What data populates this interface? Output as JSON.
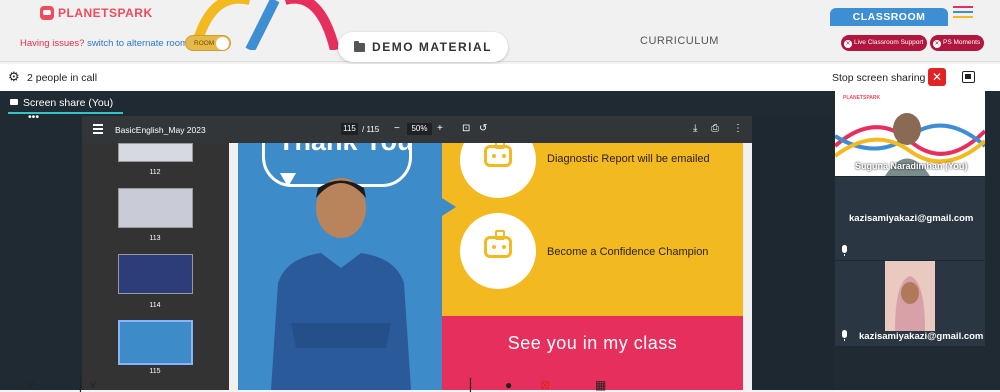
{
  "app": {
    "brand": "PLANETSPARK"
  },
  "header": {
    "issues_text": "Having issues?",
    "switch_text": "switch to alternate room",
    "toggle_label": "ROOM",
    "demo_button": "DEMO MATERIAL",
    "curriculum_label": "CURRICULUM",
    "classroom_tab": "CLASSROOM",
    "live_support": "Live Classroom Support",
    "ps_moments": "PS Moments"
  },
  "call": {
    "people_count": "2 people in call",
    "stop_share": "Stop screen sharing",
    "screen_share_tab": "Screen share (You)"
  },
  "pdf": {
    "filename": "BasicEnglish_May 2023",
    "page_current": "115",
    "page_total": "/ 115",
    "zoom": "50%",
    "thumbnails": [
      "112",
      "113",
      "114",
      "115"
    ]
  },
  "slide": {
    "thank": "Thank You",
    "item1": "Diagnostic Report will be emailed",
    "item2": "Become a Confidence Champion",
    "footer": "See you in my class"
  },
  "participants": [
    {
      "name": "Suguna Naradimhan (You)"
    },
    {
      "name": "kazisamiyakazi@gmail.com"
    },
    {
      "name": "kazisamiyakazi@gmail.com"
    }
  ],
  "colors": {
    "brand": "#ef4b5d",
    "accent": "#3d8ed3",
    "danger": "#b0163e"
  }
}
